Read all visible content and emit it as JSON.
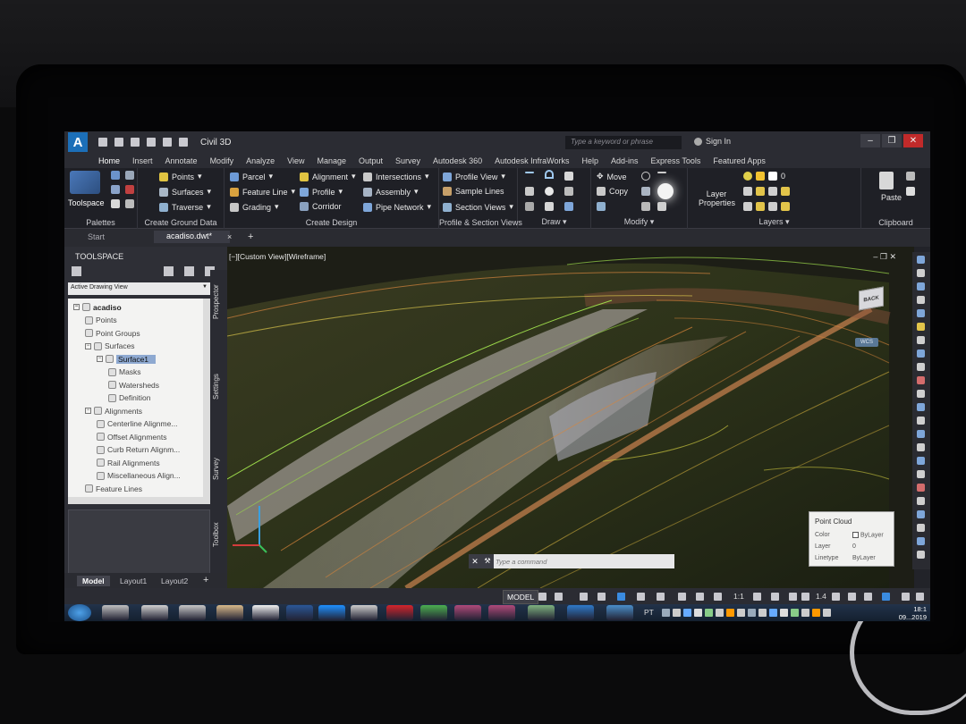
{
  "window": {
    "workspace": "Civil 3D",
    "search_placeholder": "Type a keyword or phrase",
    "sign_in": "Sign In"
  },
  "ribbon_tabs": [
    "Home",
    "Insert",
    "Annotate",
    "Modify",
    "Analyze",
    "View",
    "Manage",
    "Output",
    "Survey",
    "Autodesk 360",
    "Autodesk InfraWorks",
    "Help",
    "Add-ins",
    "Express Tools",
    "Featured Apps"
  ],
  "ribbon": {
    "toolspace": "Toolspace",
    "palettes": "Palettes",
    "points": "Points",
    "surfaces": "Surfaces",
    "traverse": "Traverse",
    "create_ground_data": "Create Ground Data",
    "parcel": "Parcel",
    "feature_line": "Feature Line",
    "grading": "Grading",
    "alignment": "Alignment",
    "profile": "Profile",
    "corridor": "Corridor",
    "intersections": "Intersections",
    "assembly": "Assembly",
    "pipe_network": "Pipe Network",
    "create_design": "Create Design",
    "profile_view": "Profile View",
    "sample_lines": "Sample Lines",
    "section_views": "Section Views",
    "profile_section_views": "Profile & Section Views",
    "draw": "Draw",
    "move": "Move",
    "copy": "Copy",
    "modify": "Modify",
    "layer_properties": "Layer Properties",
    "layer_zero": "0",
    "layers": "Layers",
    "paste": "Paste",
    "clipboard": "Clipboard"
  },
  "doc_tabs": {
    "start": "Start",
    "active": "acadiso.dwt*"
  },
  "toolspace": {
    "title": "TOOLSPACE",
    "view_select": "Active Drawing View",
    "tree": [
      {
        "label": "acadiso",
        "level": 0,
        "bold": true
      },
      {
        "label": "Points",
        "level": 1
      },
      {
        "label": "Point Groups",
        "level": 1
      },
      {
        "label": "Surfaces",
        "level": 1
      },
      {
        "label": "Surface1",
        "level": 2,
        "selected": true
      },
      {
        "label": "Masks",
        "level": 3
      },
      {
        "label": "Watersheds",
        "level": 3
      },
      {
        "label": "Definition",
        "level": 3
      },
      {
        "label": "Alignments",
        "level": 1
      },
      {
        "label": "Centerline Alignme...",
        "level": 2
      },
      {
        "label": "Offset Alignments",
        "level": 2
      },
      {
        "label": "Curb Return Alignm...",
        "level": 2
      },
      {
        "label": "Rail Alignments",
        "level": 2
      },
      {
        "label": "Miscellaneous Align...",
        "level": 2
      },
      {
        "label": "Feature Lines",
        "level": 1
      }
    ],
    "side_tabs": [
      "Prospector",
      "Settings",
      "Survey",
      "Toolbox"
    ]
  },
  "layout_tabs": [
    "Model",
    "Layout1",
    "Layout2"
  ],
  "viewport": {
    "label": "[−][Custom View][Wireframe]",
    "viewcube_face": "BACK",
    "wcs": "WCS"
  },
  "properties": {
    "title": "Point Cloud",
    "rows": [
      {
        "key": "Color",
        "value": "ByLayer"
      },
      {
        "key": "Layer",
        "value": "0"
      },
      {
        "key": "Linetype",
        "value": "ByLayer"
      }
    ]
  },
  "command": {
    "placeholder": "Type a command"
  },
  "statusbar": {
    "model": "MODEL",
    "scale": "1:1",
    "num": "1.4"
  },
  "taskbar": {
    "lang": "PT",
    "time": "18:1",
    "date": "09...2019"
  },
  "colors": {
    "accent": "#1c6fb8",
    "contour_green": "#9bd84a",
    "contour_orange": "#d8853a"
  }
}
